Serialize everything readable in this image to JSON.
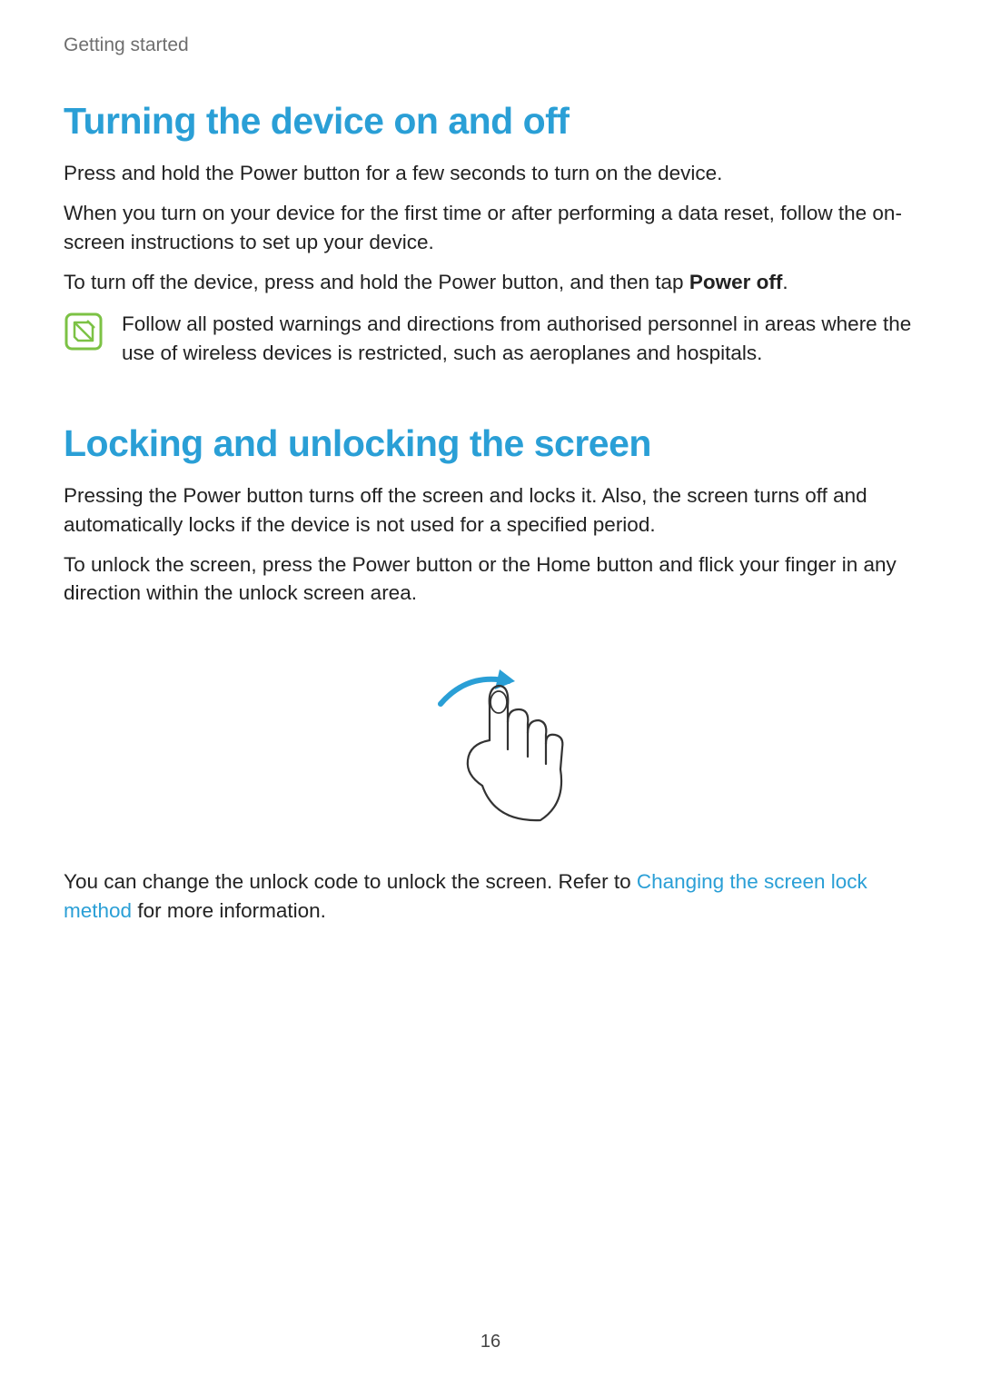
{
  "breadcrumb": "Getting started",
  "section1": {
    "title": "Turning the device on and off",
    "p1": "Press and hold the Power button for a few seconds to turn on the device.",
    "p2": "When you turn on your device for the first time or after performing a data reset, follow the on-screen instructions to set up your device.",
    "p3_prefix": "To turn off the device, press and hold the Power button, and then tap ",
    "p3_bold": "Power off",
    "p3_suffix": ".",
    "note": "Follow all posted warnings and directions from authorised personnel in areas where the use of wireless devices is restricted, such as aeroplanes and hospitals."
  },
  "section2": {
    "title": "Locking and unlocking the screen",
    "p1": "Pressing the Power button turns off the screen and locks it. Also, the screen turns off and automatically locks if the device is not used for a specified period.",
    "p2": "To unlock the screen, press the Power button or the Home button and flick your finger in any direction within the unlock screen area.",
    "p3_prefix": "You can change the unlock code to unlock the screen. Refer to ",
    "p3_link": "Changing the screen lock method",
    "p3_suffix": " for more information."
  },
  "page_number": "16"
}
